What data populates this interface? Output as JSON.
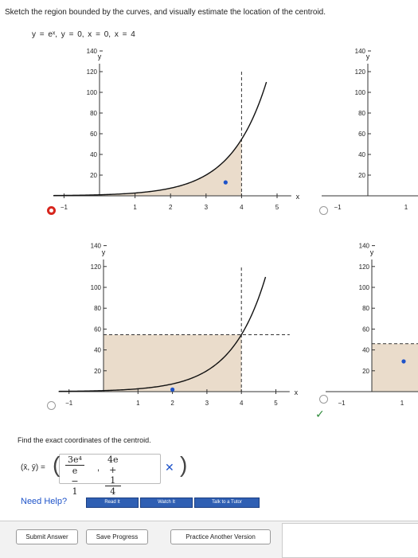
{
  "instruction": "Sketch the region bounded by the curves, and visually estimate the location of the centroid.",
  "equations": "y = eˣ,    y = 0,    x = 0,    x = 4",
  "colors": {
    "region_fill": "#eadccb",
    "curve": "#111111",
    "marker_blue": "#1e53c9",
    "selected_radio": "#d7261e",
    "checkmark": "#2e8b3a",
    "help_blue": "#1e53c9",
    "button_blue": "#2f5fb3"
  },
  "graph_labels": {
    "x_axis": "x",
    "y_axis": "y",
    "y_ticks": [
      "140",
      "120",
      "100",
      "80",
      "60",
      "40",
      "20"
    ],
    "x_ticks": [
      "−1",
      "1",
      "2",
      "3",
      "4",
      "5"
    ],
    "partial_y_ticks": [
      "140",
      "120",
      "100",
      "80",
      "60",
      "40",
      "20"
    ],
    "partial_x_ticks": [
      "−1",
      "1"
    ]
  },
  "chart_data": [
    {
      "type": "area",
      "curve": "y = e^x",
      "x": [
        0,
        0.5,
        1,
        1.5,
        2,
        2.5,
        3,
        3.5,
        4,
        4.5
      ],
      "y": [
        1,
        1.65,
        2.72,
        4.48,
        7.39,
        12.18,
        20.09,
        33.12,
        54.6,
        90.02
      ],
      "shaded_region": {
        "x_from": 0,
        "x_to": 4
      },
      "marker": {
        "x": 3.55,
        "y": 13
      },
      "xlim": [
        -1.3,
        5.4
      ],
      "ylim": [
        0,
        150
      ],
      "state": "selected"
    },
    {
      "type": "area",
      "curve": "y = e^x",
      "x": [
        0,
        0.5,
        1,
        1.5,
        2,
        2.5,
        3,
        3.5,
        4,
        4.5
      ],
      "y": [
        1,
        1.65,
        2.72,
        4.48,
        7.39,
        12.18,
        20.09,
        33.12,
        54.6,
        90.02
      ],
      "shaded_region": {
        "x_from": 0,
        "x_to": 4,
        "y_to": 54.6,
        "shape": "rectangle"
      },
      "marker": {
        "x": 2.0,
        "y": 2
      },
      "xlim": [
        -1.3,
        5.4
      ],
      "ylim": [
        0,
        150
      ],
      "state": "correct"
    }
  ],
  "find_label": "Find the exact coordinates of the centroid.",
  "centroid": {
    "xy_label": "(x̄, ȳ) =",
    "open_paren": "(",
    "close_paren": ")",
    "x_num": "3e⁴",
    "x_den": "e − 1",
    "comma": ",",
    "y_num": "4e + 1",
    "y_den": "4",
    "status_mark": "✕"
  },
  "correct_mark": "✓",
  "help": {
    "label": "Need Help?",
    "read_it": "Read It",
    "watch_it": "Watch It",
    "talk_to_tutor": "Talk to a Tutor"
  },
  "buttons": {
    "submit": "Submit Answer",
    "save": "Save Progress",
    "practice": "Practice Another Version"
  }
}
